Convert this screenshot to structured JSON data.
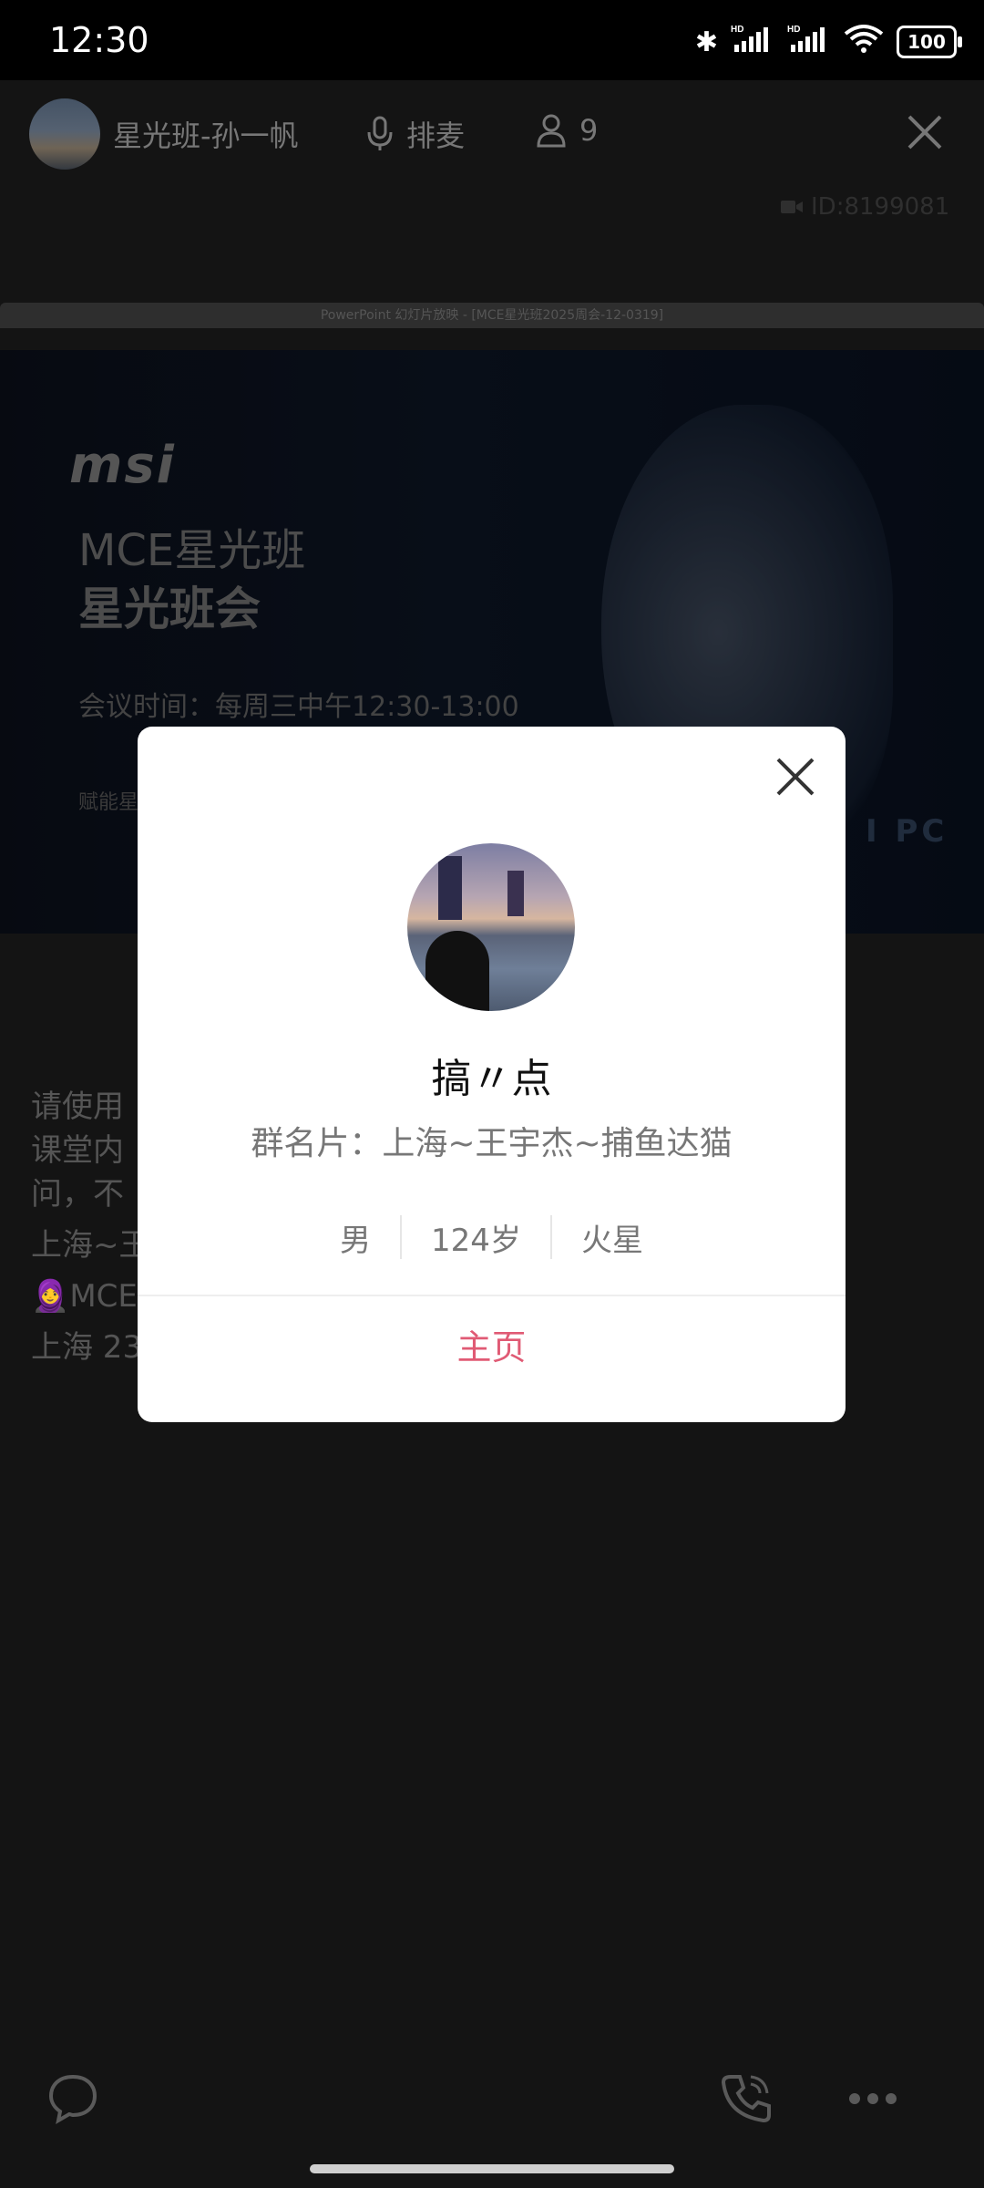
{
  "status_bar": {
    "time": "12:30",
    "battery": "100",
    "icons": [
      "bluetooth-icon",
      "signal-hd-icon",
      "signal-hd-icon",
      "wifi-icon",
      "battery-icon"
    ]
  },
  "header": {
    "room_name": "星光班-孙一帆",
    "mic_label": "排麦",
    "user_count": "9",
    "room_id": "ID:8199081"
  },
  "presentation": {
    "titlebar": "PowerPoint 幻灯片放映 - [MCE星光班2025周会-12-0319]",
    "brand": "msi",
    "subtitle": "MCE星光班",
    "title": "星光班会",
    "meeting_time": "会议时间：每周三中午12:30-13:00",
    "empower": "赋能星",
    "pc_text": "I PC"
  },
  "messages": [
    "请使用",
    "课堂内",
    "问，不",
    "上海~王",
    "🧕MCE星",
    "上海 23"
  ],
  "profile_dialog": {
    "name": "搞〃点",
    "group_card": "群名片：上海~王宇杰~捕鱼达猫",
    "gender": "男",
    "age": "124岁",
    "location": "火星",
    "home_button": "主页"
  },
  "colors": {
    "accent": "#e05a74",
    "background": "#141414",
    "dialog_bg": "#ffffff"
  }
}
